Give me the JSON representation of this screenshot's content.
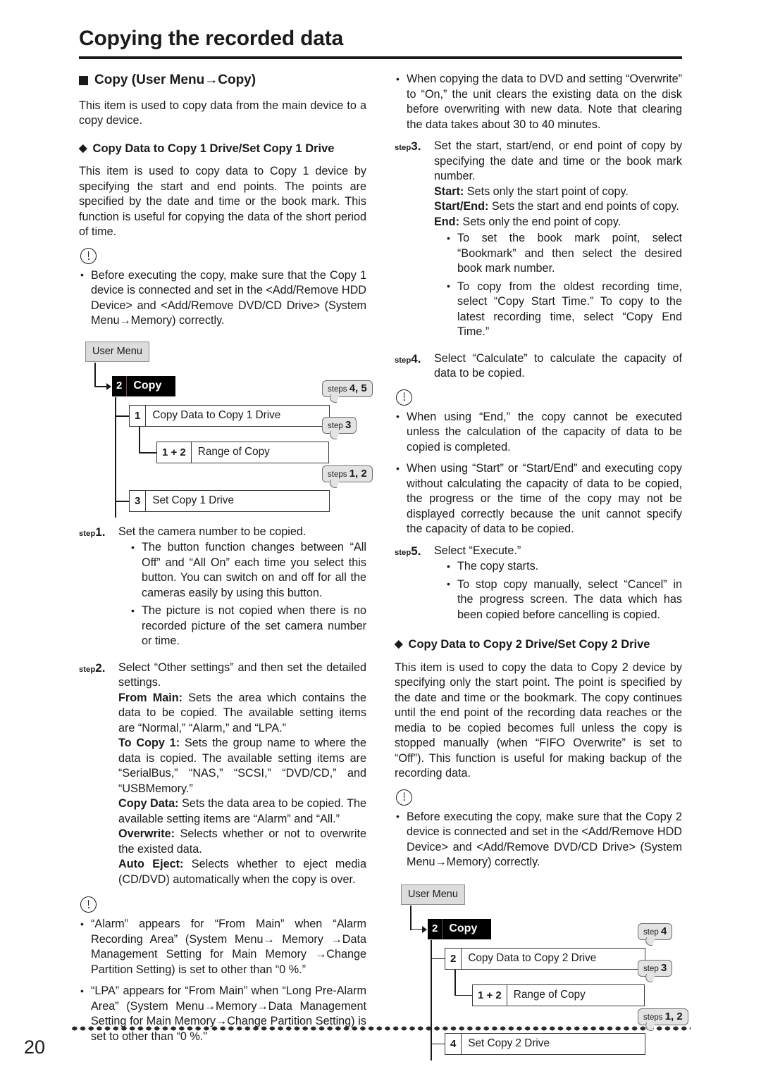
{
  "page": {
    "title": "Copying the recorded data",
    "number": "20"
  },
  "left": {
    "section_heading": "Copy (User Menu→Copy)",
    "intro": "This item is used to copy data from the main device to a copy device.",
    "sub_heading": "Copy Data to Copy 1 Drive/Set Copy 1 Drive",
    "sub_intro": "This item is used to copy data to Copy 1 device by specifying the start and end points. The points are specified by the date and time or the book mark. This function is useful for copying the data of the short period of time.",
    "note_1": "Before executing the copy, make sure that the Copy 1 device is connected and set in the <Add/Remove HDD Device> and <Add/Remove DVD/CD Drive> (System Menu→Memory) correctly.",
    "steps": [
      {
        "label_prefix": "step",
        "label_number": "1.",
        "text": "Set the camera number to be copied.",
        "bullets": [
          "The button function changes between “All Off” and  “All On” each time you select this button. You can switch on and off for all the cameras easily by using this button.",
          "The picture is not copied when there is no recorded picture of the set camera number or time."
        ]
      },
      {
        "label_prefix": "step",
        "label_number": "2.",
        "text": "Select “Other settings” and then set the detailed settings.",
        "definitions": [
          {
            "term": "From Main:",
            "desc": " Sets the area which contains the data to be copied. The available setting items are “Normal,” “Alarm,” and “LPA.”"
          },
          {
            "term": "To Copy 1:",
            "desc": " Sets the group name to where the data is copied. The available setting items are “SerialBus,” “NAS,” “SCSI,” “DVD/CD,” and “USBMemory.”"
          },
          {
            "term": "Copy Data:",
            "desc": " Sets the data area to be copied. The available setting items are “Alarm” and “All.”"
          },
          {
            "term": "Overwrite:",
            "desc": " Selects whether or not to overwrite the existed data."
          },
          {
            "term": "Auto Eject:",
            "desc": " Selects whether to eject media (CD/DVD) automatically when the copy is over."
          }
        ]
      }
    ],
    "note_2": [
      "“Alarm” appears for “From Main” when “Alarm Recording Area” (System Menu→ Memory →Data Management Setting for Main Memory →Change Partition Setting) is set to other than “0 %.”",
      "“LPA” appears for “From Main” when “Long Pre-Alarm Area” (System Menu→Memory→Data Management Setting for Main Memory→Change Partition Setting) is set to other than “0 %.\""
    ]
  },
  "right": {
    "note_0": "When copying the data to DVD and setting “Overwrite” to “On,” the unit clears the existing data on the disk before overwriting with new data. Note that clearing the data takes about 30 to 40 minutes.",
    "steps": [
      {
        "label_prefix": "step",
        "label_number": "3.",
        "text": "Set the start, start/end, or end point of copy by specifying the date and time or the book mark number.",
        "definitions": [
          {
            "term": "Start:",
            "desc": " Sets only the start point of copy."
          },
          {
            "term": "Start/End:",
            "desc": " Sets the start and end points of copy."
          },
          {
            "term": "End:",
            "desc": " Sets only the end point of copy."
          }
        ],
        "bullets": [
          "To set the book mark point, select “Bookmark” and then select the desired book mark number.",
          "To copy from the oldest recording time, select “Copy Start Time.” To copy to the latest recording time, select “Copy End Time.”"
        ]
      },
      {
        "label_prefix": "step",
        "label_number": "4.",
        "text": "Select “Calculate” to calculate the capacity of data to be copied."
      },
      {
        "label_prefix": "step",
        "label_number": "5.",
        "text": "Select “Execute.”",
        "bullets": [
          "The copy starts.",
          "To stop copy manually, select “Cancel” in the progress screen. The data which has been copied before cancelling is copied."
        ]
      }
    ],
    "note_1": [
      "When using “End,” the copy cannot be executed unless the calculation of the capacity of data to be copied is completed.",
      "When using “Start” or “Start/End” and executing copy without calculating the capacity of data to be copied, the progress or the time of the copy may not be displayed correctly because the unit cannot specify the capacity of data to be copied."
    ],
    "sub_heading": "Copy Data to Copy 2 Drive/Set Copy 2 Drive",
    "sub_intro": "This item is used to copy the data to Copy 2 device by specifying only the start point. The point is specified by the date and time or the bookmark. The copy continues until the end point of the recording data reaches or the media to be copied becomes full unless the copy is stopped manually (when “FIFO Overwrite” is set to “Off”). This function is useful for making backup of the recording data.",
    "note_2": "Before executing the copy, make sure that the Copy 2 device is connected and set in the <Add/Remove HDD Device> and <Add/Remove DVD/CD Drive> (System Menu→Memory) correctly."
  },
  "diagram1": {
    "root": "User Menu",
    "menu": {
      "num": "2",
      "label": "Copy"
    },
    "rows": [
      {
        "num": "1",
        "label": "Copy Data to Copy 1 Drive",
        "bubble_prefix": "steps ",
        "bubble_number": "4, 5"
      },
      {
        "num": "1 + 2",
        "label": "Range of Copy",
        "bubble_prefix": "step ",
        "bubble_number": "3"
      },
      {
        "num": "3",
        "label": "Set Copy 1 Drive",
        "bubble_prefix": "steps ",
        "bubble_number": "1, 2"
      }
    ]
  },
  "diagram2": {
    "root": "User Menu",
    "menu": {
      "num": "2",
      "label": "Copy"
    },
    "rows": [
      {
        "num": "2",
        "label": "Copy Data to Copy 2 Drive",
        "bubble_prefix": "step ",
        "bubble_number": "4"
      },
      {
        "num": "1 + 2",
        "label": "Range of Copy",
        "bubble_prefix": "step ",
        "bubble_number": "3"
      },
      {
        "num": "4",
        "label": "Set Copy 2 Drive",
        "bubble_prefix": "steps ",
        "bubble_number": "1, 2"
      }
    ]
  }
}
